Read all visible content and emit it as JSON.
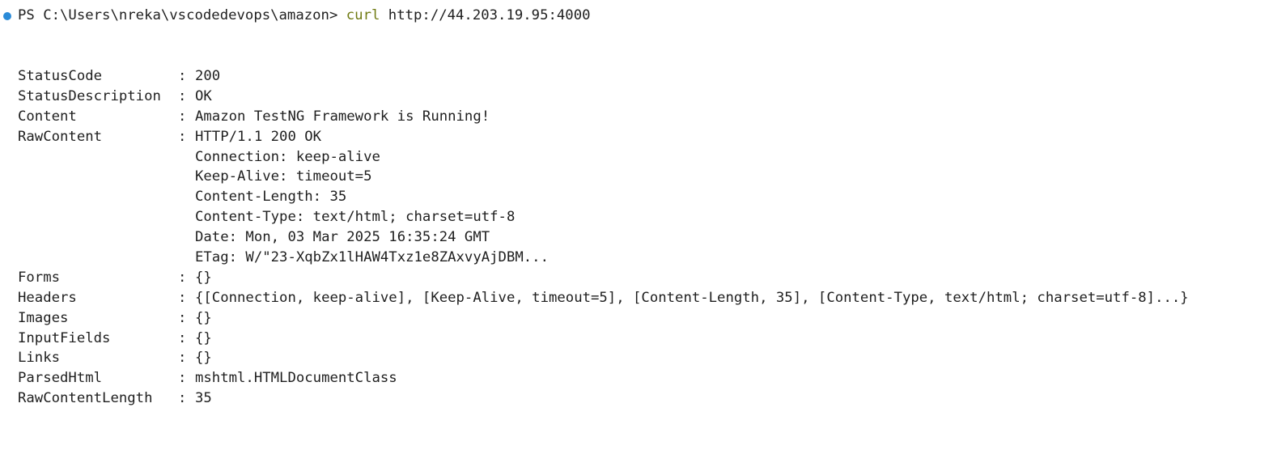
{
  "colors": {
    "status_dot": "#2a8bd8",
    "command": "#6f7a12",
    "text": "#1f1f1f",
    "background": "#ffffff"
  },
  "prompt": {
    "status_icon": "circle-dot",
    "path": "PS C:\\Users\\nreka\\vscodedevops\\amazon>",
    "command": "curl",
    "argument": "http://44.203.19.95:4000"
  },
  "output": [
    {
      "key": "StatusCode",
      "sep": ":",
      "value": "200"
    },
    {
      "key": "StatusDescription",
      "sep": ":",
      "value": "OK"
    },
    {
      "key": "Content",
      "sep": ":",
      "value": "Amazon TestNG Framework is Running!"
    },
    {
      "key": "RawContent",
      "sep": ":",
      "value": "HTTP/1.1 200 OK"
    },
    {
      "key": "",
      "sep": "",
      "value": "Connection: keep-alive"
    },
    {
      "key": "",
      "sep": "",
      "value": "Keep-Alive: timeout=5"
    },
    {
      "key": "",
      "sep": "",
      "value": "Content-Length: 35"
    },
    {
      "key": "",
      "sep": "",
      "value": "Content-Type: text/html; charset=utf-8"
    },
    {
      "key": "",
      "sep": "",
      "value": "Date: Mon, 03 Mar 2025 16:35:24 GMT"
    },
    {
      "key": "",
      "sep": "",
      "value": "ETag: W/\"23-XqbZx1lHAW4Txz1e8ZAxvyAjDBM..."
    },
    {
      "key": "Forms",
      "sep": ":",
      "value": "{}"
    },
    {
      "key": "Headers",
      "sep": ":",
      "value": "{[Connection, keep-alive], [Keep-Alive, timeout=5], [Content-Length, 35], [Content-Type, text/html; charset=utf-8]...}"
    },
    {
      "key": "Images",
      "sep": ":",
      "value": "{}"
    },
    {
      "key": "InputFields",
      "sep": ":",
      "value": "{}"
    },
    {
      "key": "Links",
      "sep": ":",
      "value": "{}"
    },
    {
      "key": "ParsedHtml",
      "sep": ":",
      "value": "mshtml.HTMLDocumentClass"
    },
    {
      "key": "RawContentLength",
      "sep": ":",
      "value": "35"
    }
  ]
}
